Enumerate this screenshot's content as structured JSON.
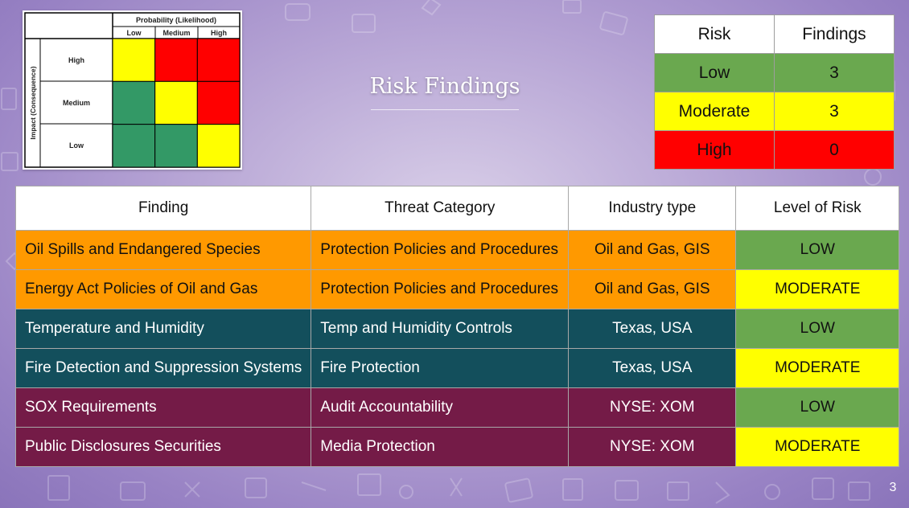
{
  "slide": {
    "title": "Risk Findings",
    "page_number": "3"
  },
  "risk_matrix": {
    "probability_header": "Probability (Likelihood)",
    "impact_header": "Impact (Consequence)",
    "columns": [
      "Low",
      "Medium",
      "High"
    ],
    "rows": [
      "High",
      "Medium",
      "Low"
    ],
    "cells": [
      [
        "yellow",
        "red",
        "red"
      ],
      [
        "green",
        "yellow",
        "red"
      ],
      [
        "green",
        "green",
        "yellow"
      ]
    ],
    "colors": {
      "yellow": "#ffff00",
      "red": "#ff0000",
      "green": "#339966"
    }
  },
  "summary": {
    "headers": [
      "Risk",
      "Findings"
    ],
    "rows": [
      {
        "risk": "Low",
        "findings": "3",
        "color": "#6aa84f"
      },
      {
        "risk": "Moderate",
        "findings": "3",
        "color": "#ffff00"
      },
      {
        "risk": "High",
        "findings": "0",
        "color": "#ff0000"
      }
    ]
  },
  "findings": {
    "headers": [
      "Finding",
      "Threat Category",
      "Industry type",
      "Level of Risk"
    ],
    "rows": [
      {
        "finding": "Oil Spills and Endangered Species",
        "category": "Protection Policies and Procedures",
        "industry": "Oil and Gas, GIS",
        "risk": "LOW",
        "row_color": "#ff9900",
        "text_color": "#111111",
        "risk_color": "#6aa84f"
      },
      {
        "finding": "Energy Act Policies of Oil and Gas",
        "category": "Protection Policies and Procedures",
        "industry": "Oil and Gas, GIS",
        "risk": "MODERATE",
        "row_color": "#ff9900",
        "text_color": "#111111",
        "risk_color": "#ffff00"
      },
      {
        "finding": "Temperature and Humidity",
        "category": "Temp and Humidity Controls",
        "industry": "Texas, USA",
        "risk": "LOW",
        "row_color": "#134f5c",
        "text_color": "#ffffff",
        "risk_color": "#6aa84f"
      },
      {
        "finding": "Fire Detection and Suppression Systems",
        "category": "Fire Protection",
        "industry": "Texas, USA",
        "risk": "MODERATE",
        "row_color": "#134f5c",
        "text_color": "#ffffff",
        "risk_color": "#ffff00"
      },
      {
        "finding": "SOX Requirements",
        "category": "Audit Accountability",
        "industry": "NYSE: XOM",
        "risk": "LOW",
        "row_color": "#741b47",
        "text_color": "#ffffff",
        "risk_color": "#6aa84f"
      },
      {
        "finding": "Public Disclosures Securities",
        "category": "Media Protection",
        "industry": "NYSE: XOM",
        "risk": "MODERATE",
        "row_color": "#741b47",
        "text_color": "#ffffff",
        "risk_color": "#ffff00"
      }
    ]
  }
}
